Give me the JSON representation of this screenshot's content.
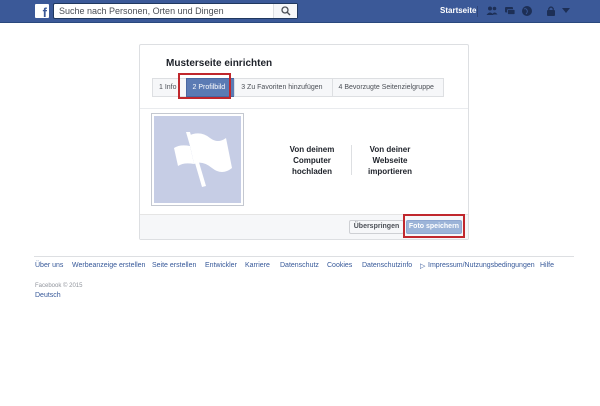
{
  "topbar": {
    "logo": "f",
    "search_placeholder": "Suche nach Personen, Orten und Dingen",
    "home_label": "Startseite",
    "icons": [
      "friends-icon",
      "messages-icon",
      "notifications-globe-icon",
      "privacy-lock-icon",
      "account-menu-icon"
    ]
  },
  "card": {
    "title": "Musterseite einrichten",
    "steps": [
      {
        "label": "1 Info",
        "active": false
      },
      {
        "label": "2 Profilbild",
        "active": true
      },
      {
        "label": "3 Zu Favoriten hinzufügen",
        "active": false
      },
      {
        "label": "4 Bevorzugte Seitenzielgruppe",
        "active": false
      }
    ],
    "upload_computer": "Von deinem Computer hochladen",
    "upload_website": "Von deiner Webseite importieren",
    "skip_label": "Überspringen",
    "save_label": "Foto speichern"
  },
  "footer": {
    "links": [
      "Über uns",
      "Werbeanzeige erstellen",
      "Seite erstellen",
      "Entwickler",
      "Karriere",
      "Datenschutz",
      "Cookies",
      "Datenschutzinfo",
      "Impressum/Nutzungsbedingungen",
      "Hilfe"
    ],
    "copyright": "Facebook © 2015",
    "language": "Deutsch"
  },
  "colors": {
    "brand": "#3b5998",
    "active_step": "#5b7bb4",
    "highlight": "#c0272d",
    "save_button": "#9cb4d8",
    "placeholder_photo": "#c6cde5"
  }
}
